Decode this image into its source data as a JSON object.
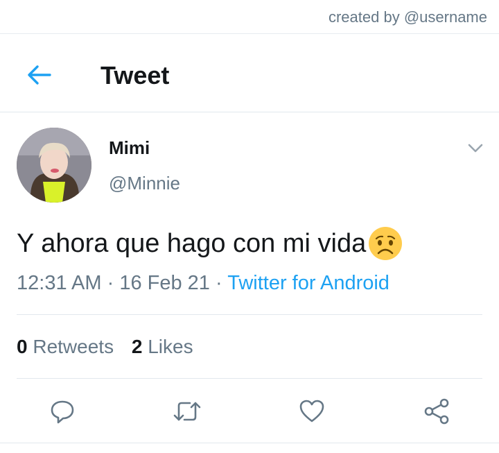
{
  "watermark": "created by @username",
  "header": {
    "title": "Tweet",
    "back_icon": "arrow-left-icon"
  },
  "tweet": {
    "author_name": "Mimi",
    "author_handle": "@Minnie",
    "text": "Y ahora que hago con mi vida",
    "emoji": "worried-face",
    "time": "12:31 AM",
    "date": "16 Feb 21",
    "separator": "·",
    "source": "Twitter for Android",
    "retweets_count": "0",
    "retweets_label": "Retweets",
    "likes_count": "2",
    "likes_label": "Likes"
  },
  "colors": {
    "accent": "#1da1f2",
    "secondary_text": "#657786",
    "divider": "#e1e8ed"
  },
  "actions": [
    "reply-icon",
    "retweet-icon",
    "like-icon",
    "share-icon"
  ]
}
